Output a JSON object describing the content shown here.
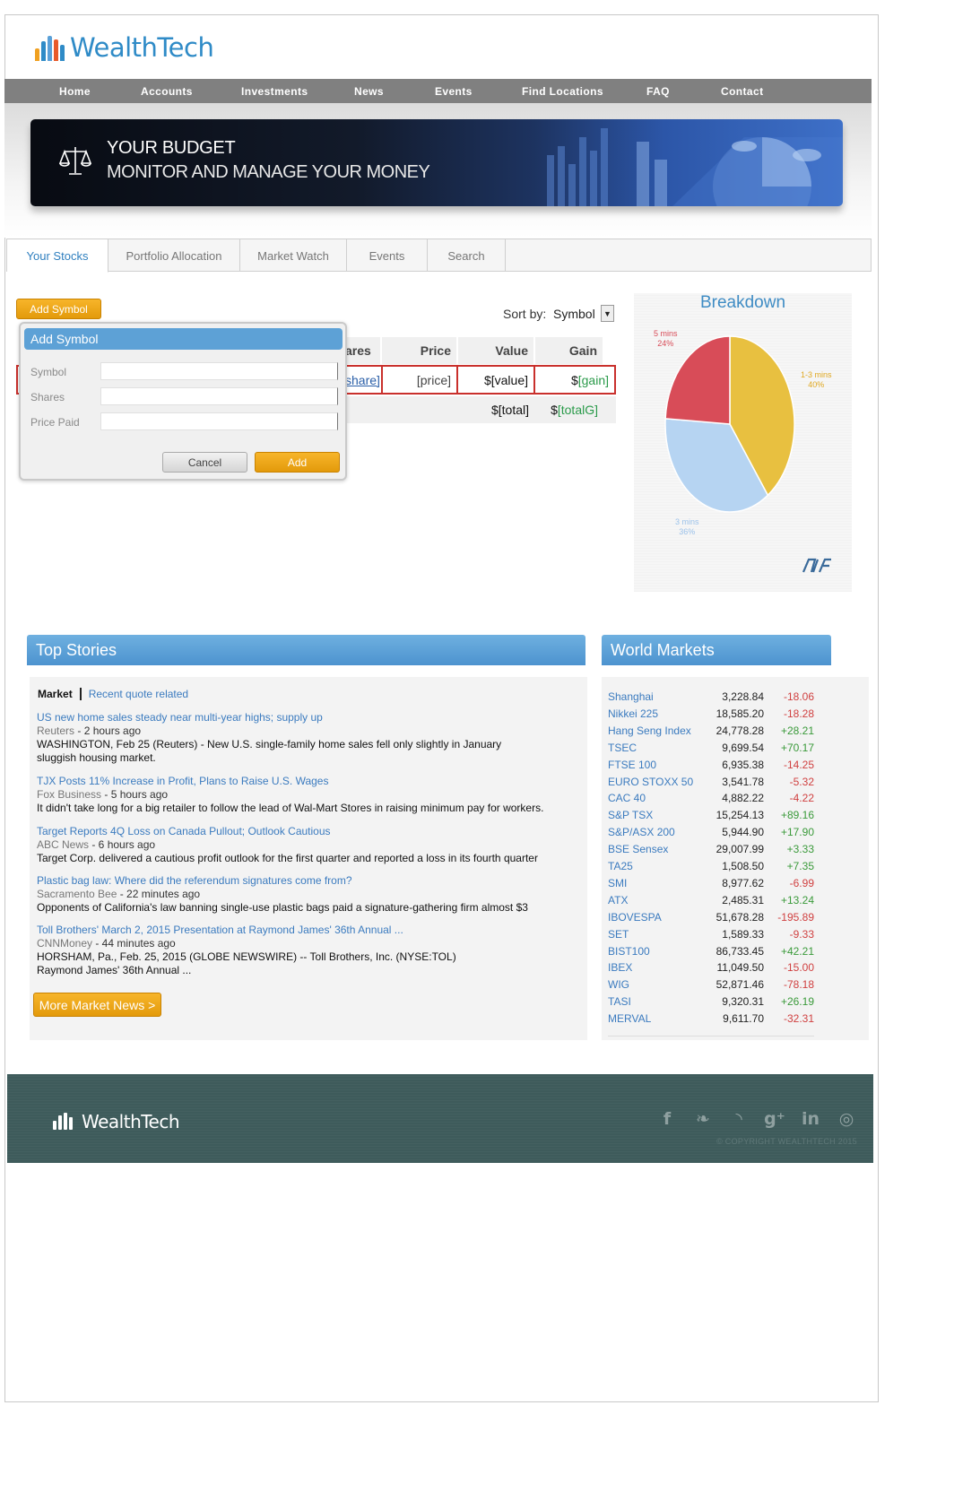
{
  "brand": {
    "name": "WealthTech"
  },
  "nav": {
    "items": [
      "Home",
      "Accounts",
      "Investments",
      "News",
      "Events",
      "Find Locations",
      "FAQ",
      "Contact"
    ]
  },
  "banner": {
    "title": "YOUR BUDGET",
    "subtitle": "MONITOR AND MANAGE YOUR MONEY"
  },
  "tabs": [
    "Your Stocks",
    "Portfolio Allocation",
    "Market Watch",
    "Events",
    "Search"
  ],
  "stocks": {
    "add_symbol_label": "Add Symbol",
    "sort_label": "Sort by:",
    "sort_value": "Symbol",
    "columns": [
      "ares",
      "Price",
      "Value",
      "Gain"
    ],
    "row": {
      "shares": "share]",
      "price": "[price]",
      "value_prefix": "$",
      "value": "[value]",
      "gain_prefix": "$",
      "gain": "[gain]"
    },
    "totals": {
      "total": "$[total]",
      "gain_prefix": "$",
      "total_gain": "[totalG]"
    }
  },
  "popup": {
    "title": "Add Symbol",
    "fields": [
      {
        "label": "Symbol",
        "value": ""
      },
      {
        "label": "Shares",
        "value": ""
      },
      {
        "label": "Price Paid",
        "value": ""
      }
    ],
    "cancel_label": "Cancel",
    "add_label": "Add"
  },
  "breakdown": {
    "title": "Breakdown",
    "colors": {
      "a": "#e8c040",
      "b": "#b6d4f2",
      "c": "#d84c58"
    },
    "slices": [
      {
        "label": "1-3 mins",
        "pct": "40%",
        "value": 40,
        "color": "#e8c040"
      },
      {
        "label": "3 mins",
        "pct": "36%",
        "value": 36,
        "color": "#b6d4f2"
      },
      {
        "label": "5 mins",
        "pct": "24%",
        "value": 24,
        "color": "#d84c58"
      }
    ]
  },
  "top_stories": {
    "title": "Top Stories",
    "tab_market": "Market",
    "tab_recent": "Recent quote related",
    "stories": [
      {
        "title": "US new home sales steady near multi-year highs; supply up",
        "source": "Reuters",
        "time": " - 2 hours ago",
        "desc": "WASHINGTON, Feb 25 (Reuters) - New U.S. single-family home sales fell only slightly in January",
        "desc2": "sluggish housing market."
      },
      {
        "title": "TJX Posts 11% Increase in Profit, Plans to Raise U.S. Wages",
        "source": "Fox Business",
        "time": " - 5 hours ago",
        "desc": "It didn't take long for a big retailer to follow the lead of Wal-Mart Stores in raising minimum pay for workers.",
        "desc2": ""
      },
      {
        "title": "Target Reports 4Q Loss on Canada Pullout; Outlook Cautious",
        "source": "ABC News",
        "time": " - 6 hours ago",
        "desc": "Target Corp. delivered a cautious profit outlook for the first quarter and reported a loss in its fourth quarter",
        "desc2": ""
      },
      {
        "title": "Plastic bag law: Where did the referendum signatures come from?",
        "source": "Sacramento Bee",
        "time": " - 22 minutes ago",
        "desc": "Opponents of California's law banning single-use plastic bags paid a signature-gathering firm almost $3",
        "desc2": ""
      },
      {
        "title": "Toll Brothers' March 2, 2015 Presentation at Raymond James' 36th Annual ...",
        "source": "CNNMoney",
        "time": " - 44 minutes ago",
        "desc": "HORSHAM, Pa., Feb. 25, 2015 (GLOBE NEWSWIRE) -- Toll Brothers, Inc. (NYSE:TOL)",
        "desc2": "Raymond James' 36th Annual ..."
      }
    ],
    "more_label": "More Market News >"
  },
  "world_markets": {
    "title": "World Markets",
    "colors": {
      "up": "#3a9a3a",
      "down": "#d04040"
    },
    "rows": [
      {
        "name": "Shanghai",
        "value": "3,228.84",
        "change": "-18.06",
        "up": false
      },
      {
        "name": "Nikkei 225",
        "value": "18,585.20",
        "change": "-18.28",
        "up": false
      },
      {
        "name": "Hang Seng Index",
        "value": "24,778.28",
        "change": "+28.21",
        "up": true
      },
      {
        "name": "TSEC",
        "value": "9,699.54",
        "change": "+70.17",
        "up": true
      },
      {
        "name": "FTSE 100",
        "value": "6,935.38",
        "change": "-14.25",
        "up": false
      },
      {
        "name": "EURO STOXX 50",
        "value": "3,541.78",
        "change": "-5.32",
        "up": false
      },
      {
        "name": "CAC 40",
        "value": "4,882.22",
        "change": "-4.22",
        "up": false
      },
      {
        "name": "S&P TSX",
        "value": "15,254.13",
        "change": "+89.16",
        "up": true
      },
      {
        "name": "S&P/ASX 200",
        "value": "5,944.90",
        "change": "+17.90",
        "up": true
      },
      {
        "name": "BSE Sensex",
        "value": "29,007.99",
        "change": "+3.33",
        "up": true
      },
      {
        "name": "TA25",
        "value": "1,508.50",
        "change": "+7.35",
        "up": true
      },
      {
        "name": "SMI",
        "value": "8,977.62",
        "change": "-6.99",
        "up": false
      },
      {
        "name": "ATX",
        "value": "2,485.31",
        "change": "+13.24",
        "up": true
      },
      {
        "name": "IBOVESPA",
        "value": "51,678.28",
        "change": "-195.89",
        "up": false
      },
      {
        "name": "SET",
        "value": "1,589.33",
        "change": "-9.33",
        "up": false
      },
      {
        "name": "BIST100",
        "value": "86,733.45",
        "change": "+42.21",
        "up": true
      },
      {
        "name": "IBEX",
        "value": "11,049.50",
        "change": "-15.00",
        "up": false
      },
      {
        "name": "WIG",
        "value": "52,871.46",
        "change": "-78.18",
        "up": false
      },
      {
        "name": "TASI",
        "value": "9,320.31",
        "change": "+26.19",
        "up": true
      },
      {
        "name": "MERVAL",
        "value": "9,611.70",
        "change": "-32.31",
        "up": false
      }
    ]
  },
  "footer": {
    "brand": "WealthTech",
    "copyright": "© COPYRIGHT WEALTHTECH 2015",
    "social": [
      {
        "icon": "facebook-icon",
        "glyph": "f"
      },
      {
        "icon": "twitter-icon",
        "glyph": "❧"
      },
      {
        "icon": "rss-icon",
        "glyph": "◝"
      },
      {
        "icon": "google-plus-icon",
        "glyph": "g⁺"
      },
      {
        "icon": "linkedin-icon",
        "glyph": "in"
      },
      {
        "icon": "dribbble-icon",
        "glyph": "◎"
      }
    ]
  }
}
